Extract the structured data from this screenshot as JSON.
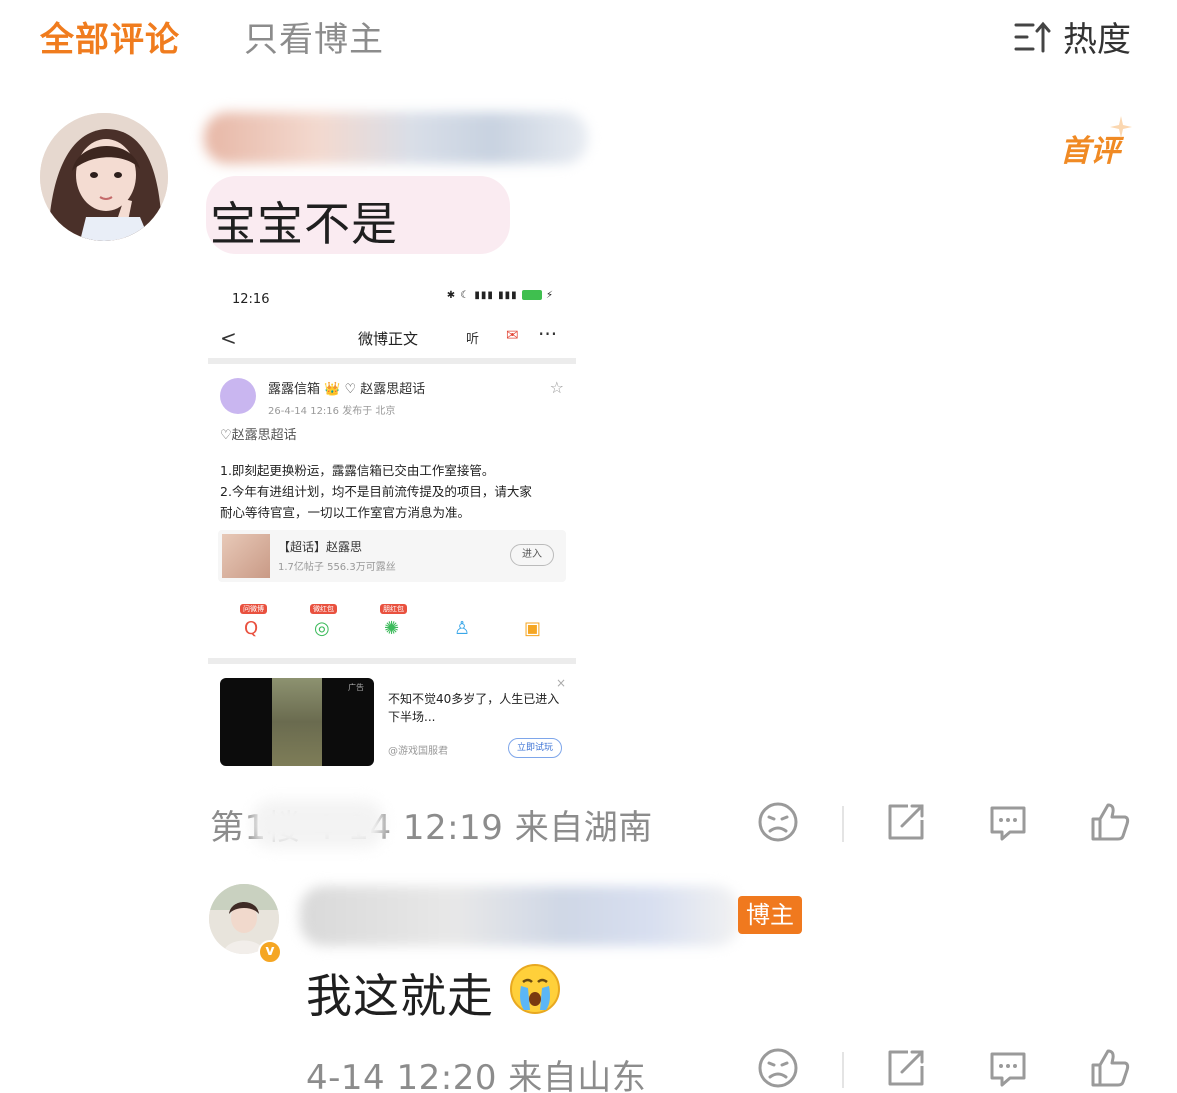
{
  "tabs": {
    "all_comments": "全部评论",
    "blogger_only": "只看博主"
  },
  "sort": {
    "label": "热度",
    "icon": "sort-icon"
  },
  "comment1": {
    "badge": "首评",
    "text": "宝宝不是",
    "meta": "第1楼 4-14 12:19 来自湖南",
    "screenshot": {
      "status_time": "12:16",
      "nav_back": "<",
      "nav_title": "微博正文",
      "nav_listen": "听",
      "nav_more": "···",
      "post_name": "露露信箱 👑 ♡ 赵露思超话",
      "post_meta": "26-4-14 12:16  发布于 北京",
      "topic": "♡赵露思超话",
      "body_line1": "1.即刻起更换粉运，露露信箱已交由工作室接管。",
      "body_line2": "2.今年有进组计划，均不是目前流传提及的项目，请大家",
      "body_line3": "耐心等待官宣，一切以工作室官方消息为准。",
      "card_title": "【超话】赵露思",
      "card_sub": "1.7亿帖子 556.3万可露丝",
      "card_button": "进入",
      "share_tags": [
        "问微博",
        "微红包",
        "朋红包"
      ],
      "ad_label": "广告",
      "ad_text": "不知不觉40多岁了，人生已进入下半场...",
      "ad_source": "@游戏国服君",
      "ad_button": "立即试玩"
    }
  },
  "reply": {
    "tag": "博主",
    "text": "我这就走",
    "meta": "4-14 12:20 来自山东"
  },
  "colors": {
    "accent": "#f07c1e",
    "muted": "#8c8c8c",
    "icon": "#9a9a9a"
  }
}
